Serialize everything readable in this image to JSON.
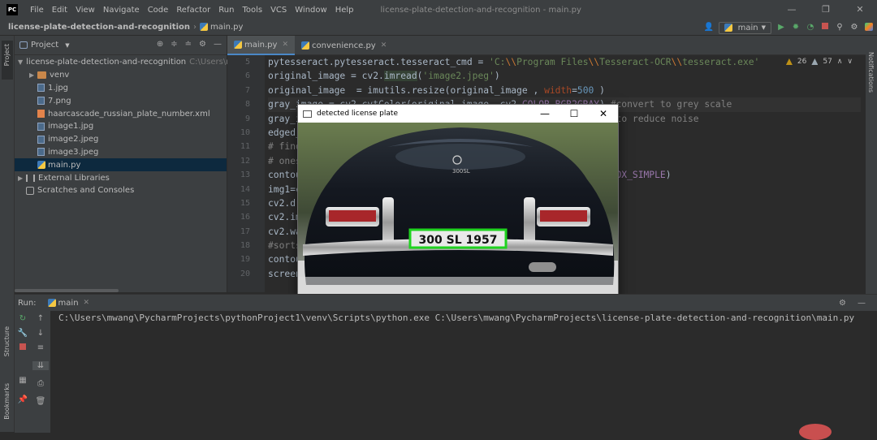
{
  "window": {
    "logo": "PC",
    "menu": [
      "File",
      "Edit",
      "View",
      "Navigate",
      "Code",
      "Refactor",
      "Run",
      "Tools",
      "VCS",
      "Window",
      "Help"
    ],
    "title": "license-plate-detection-and-recognition - main.py",
    "controls": [
      "—",
      "❐",
      "✕"
    ]
  },
  "navbar": {
    "project": "license-plate-detection-and-recognition",
    "file": "main.py",
    "branch": "main",
    "icons": [
      "user-icon",
      "python-icon",
      "run-icon",
      "debug-icon",
      "profile-icon",
      "stop-icon",
      "search-icon",
      "settings-icon",
      "jetbrains-icon"
    ]
  },
  "sidestrip": {
    "project": "Project",
    "structure": "Structure",
    "bookmarks": "Bookmarks"
  },
  "project_panel": {
    "title": "Project",
    "tree": [
      {
        "label": "license-plate-detection-and-recognition",
        "hint": "C:\\Users\\m",
        "type": "folder",
        "depth": 0,
        "arrow": "▼"
      },
      {
        "label": "venv",
        "type": "folder-orange",
        "depth": 1,
        "arrow": "▶"
      },
      {
        "label": "1.jpg",
        "type": "image",
        "depth": 1
      },
      {
        "label": "7.png",
        "type": "image",
        "depth": 1
      },
      {
        "label": "haarcascade_russian_plate_number.xml",
        "type": "xml",
        "depth": 1
      },
      {
        "label": "image1.jpg",
        "type": "image",
        "depth": 1
      },
      {
        "label": "image2.jpeg",
        "type": "image",
        "depth": 1
      },
      {
        "label": "image3.jpeg",
        "type": "image",
        "depth": 1
      },
      {
        "label": "main.py",
        "type": "python",
        "depth": 1,
        "selected": true
      },
      {
        "label": "External Libraries",
        "type": "lib",
        "depth": 0,
        "arrow": "▶"
      },
      {
        "label": "Scratches and Consoles",
        "type": "scratch",
        "depth": 0
      }
    ]
  },
  "editor": {
    "tabs": [
      {
        "label": "main.py",
        "active": true
      },
      {
        "label": "convenience.py",
        "active": false
      }
    ],
    "inspection": {
      "warnings": "26",
      "weak": "57"
    },
    "line_numbers": [
      "5",
      "6",
      "7",
      "8",
      "9",
      "10",
      "11",
      "12",
      "13",
      "14",
      "15",
      "16",
      "17",
      "18",
      "19",
      "20"
    ]
  },
  "image_window": {
    "title": "detected license plate",
    "controls": [
      "—",
      "☐",
      "✕"
    ],
    "plate_text": "300 SL 1957",
    "car_emblem": "300SL"
  },
  "run_panel": {
    "label": "Run:",
    "config": "main",
    "output": "C:\\Users\\mwang\\PycharmProjects\\pythonProject1\\venv\\Scripts\\python.exe C:\\Users\\mwang\\PycharmProjects\\license-plate-detection-and-recognition\\main.py"
  },
  "colors": {
    "plate_box": "#1fd31f",
    "accent": "#4a88c7"
  }
}
